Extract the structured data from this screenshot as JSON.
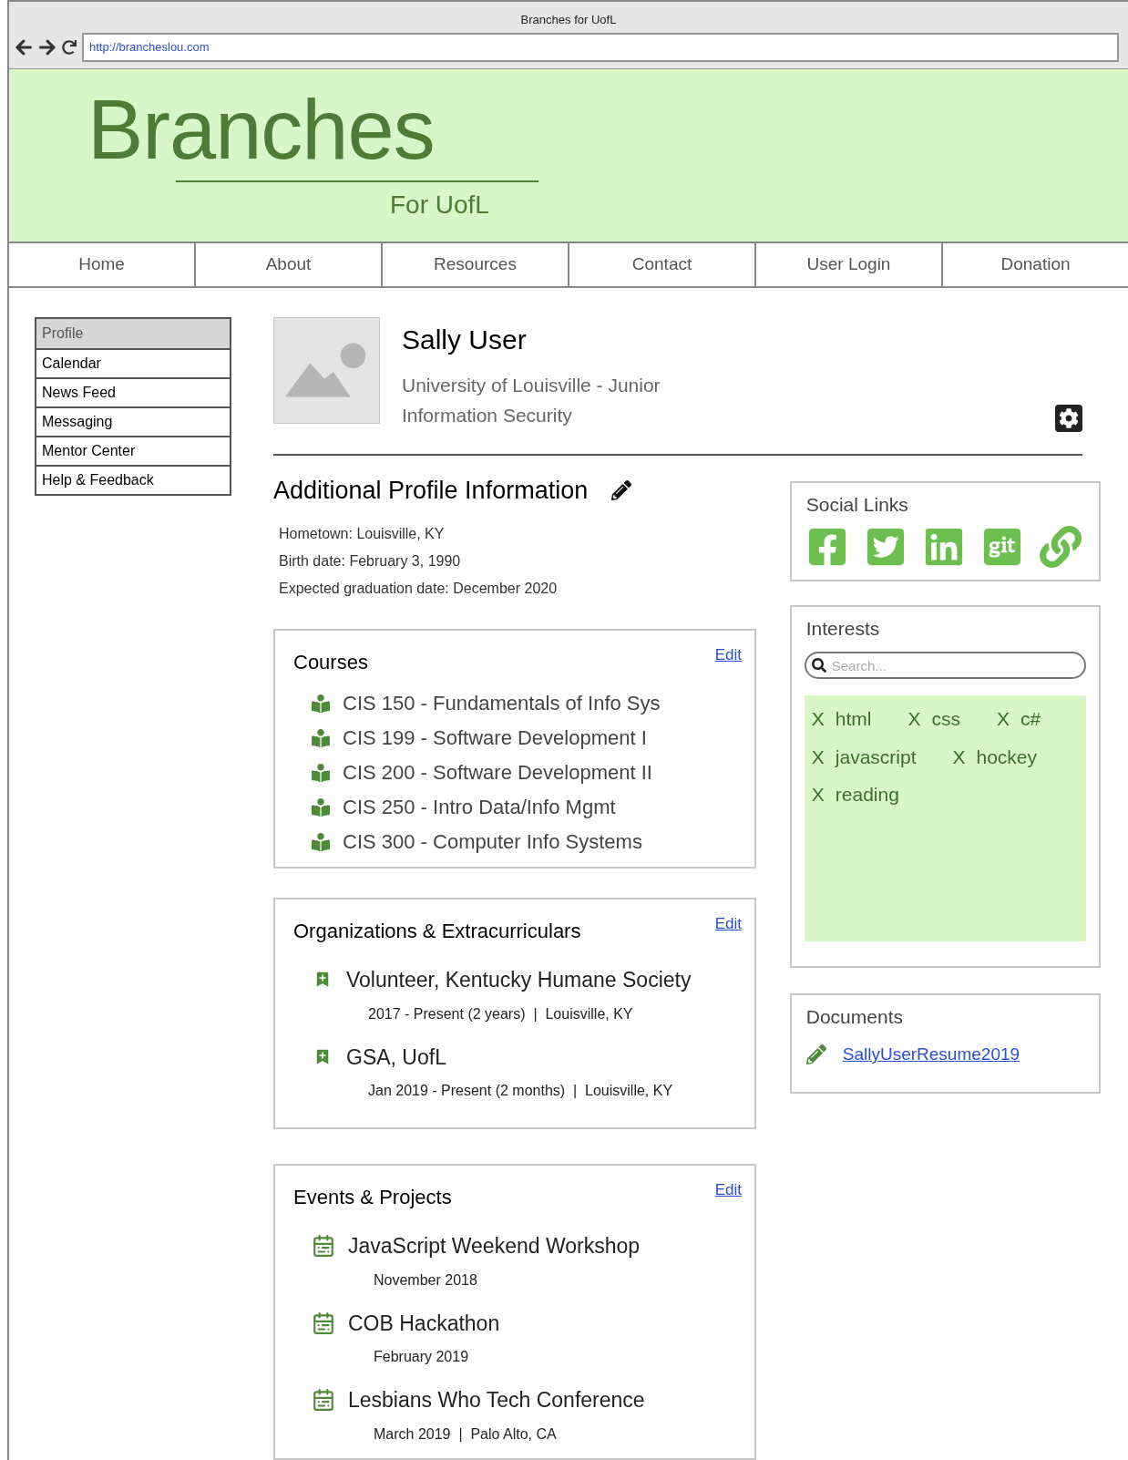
{
  "window": {
    "title": "Branches for UofL",
    "url": "http://brancheslou.com"
  },
  "header": {
    "logo": "Branches",
    "tagline": "For UofL"
  },
  "nav": [
    {
      "label": "Home"
    },
    {
      "label": "About"
    },
    {
      "label": "Resources"
    },
    {
      "label": "Contact"
    },
    {
      "label": "User Login"
    },
    {
      "label": "Donation"
    }
  ],
  "sidebar": {
    "items": [
      {
        "label": "Profile",
        "selected": true
      },
      {
        "label": "Calendar",
        "selected": false
      },
      {
        "label": "News Feed",
        "selected": false
      },
      {
        "label": "Messaging",
        "selected": false
      },
      {
        "label": "Mentor Center",
        "selected": false
      },
      {
        "label": "Help & Feedback",
        "selected": false
      }
    ]
  },
  "profile": {
    "name": "Sally User",
    "line1": "University of Louisville - Junior",
    "line2": "Information Security"
  },
  "additional": {
    "title": "Additional Profile Information",
    "fields": [
      {
        "label": "Hometown:",
        "value": "Louisville, KY"
      },
      {
        "label": "Birth date:",
        "value": "February 3, 1990"
      },
      {
        "label": "Expected graduation date:",
        "value": "December 2020"
      }
    ]
  },
  "courses": {
    "title": "Courses",
    "edit": "Edit",
    "items": [
      "CIS 150 - Fundamentals of Info Sys",
      "CIS 199 - Software Development I",
      "CIS 200 - Software Development II",
      "CIS 250 - Intro Data/Info Mgmt",
      "CIS 300 - Computer Info Systems"
    ]
  },
  "organizations": {
    "title": "Organizations & Extracurriculars",
    "edit": "Edit",
    "items": [
      {
        "name": "Volunteer, Kentucky Humane Society",
        "detail": "2017 - Present (2 years)  |  Louisville, KY"
      },
      {
        "name": "GSA, UofL",
        "detail": "Jan 2019 - Present (2 months)  |  Louisville, KY"
      }
    ]
  },
  "events": {
    "title": "Events & Projects",
    "edit": "Edit",
    "items": [
      {
        "name": "JavaScript Weekend Workshop",
        "detail": "November 2018"
      },
      {
        "name": "COB Hackathon",
        "detail": "February 2019"
      },
      {
        "name": "Lesbians Who Tech Conference",
        "detail": "March 2019  |  Palo Alto, CA"
      }
    ]
  },
  "social_links": {
    "title": "Social Links",
    "links": [
      {
        "kind": "facebook"
      },
      {
        "kind": "twitter"
      },
      {
        "kind": "linkedin"
      },
      {
        "kind": "git"
      },
      {
        "kind": "link"
      }
    ]
  },
  "interests": {
    "title": "Interests",
    "search": {
      "placeholder": "Search..."
    },
    "tag_rows": [
      [
        {
          "remove": "X",
          "label": "html"
        },
        {
          "remove": "X",
          "label": "css"
        },
        {
          "remove": "X",
          "label": "c#"
        }
      ],
      [
        {
          "remove": "X",
          "label": "javascript"
        },
        {
          "remove": "X",
          "label": "hockey"
        }
      ],
      [
        {
          "remove": "X",
          "label": "reading"
        }
      ]
    ]
  },
  "documents": {
    "title": "Documents",
    "files": [
      "SallyUserResume2019"
    ]
  }
}
